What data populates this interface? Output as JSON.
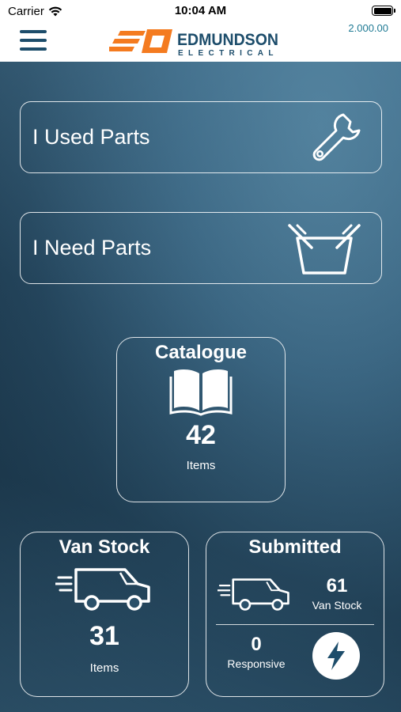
{
  "status_bar": {
    "carrier": "Carrier",
    "time": "10:04 AM"
  },
  "header": {
    "balance": "2.000.00",
    "logo_name": "EDMUNDSON",
    "logo_sub": "ELECTRICAL"
  },
  "actions": [
    {
      "label": "I Used Parts",
      "icon": "wrench-icon"
    },
    {
      "label": "I Need Parts",
      "icon": "basket-icon"
    }
  ],
  "catalogue": {
    "title": "Catalogue",
    "count": "42",
    "unit": "Items",
    "icon": "open-book-icon"
  },
  "van_stock": {
    "title": "Van Stock",
    "count": "31",
    "unit": "Items",
    "icon": "van-icon"
  },
  "submitted": {
    "title": "Submitted",
    "van_stock_count": "61",
    "van_stock_label": "Van Stock",
    "responsive_count": "0",
    "responsive_label": "Responsive",
    "icon": "lightning-icon"
  },
  "colors": {
    "header_accent": "#1d4d6b",
    "logo_orange": "#f47b20",
    "balance": "#1f7a94"
  }
}
